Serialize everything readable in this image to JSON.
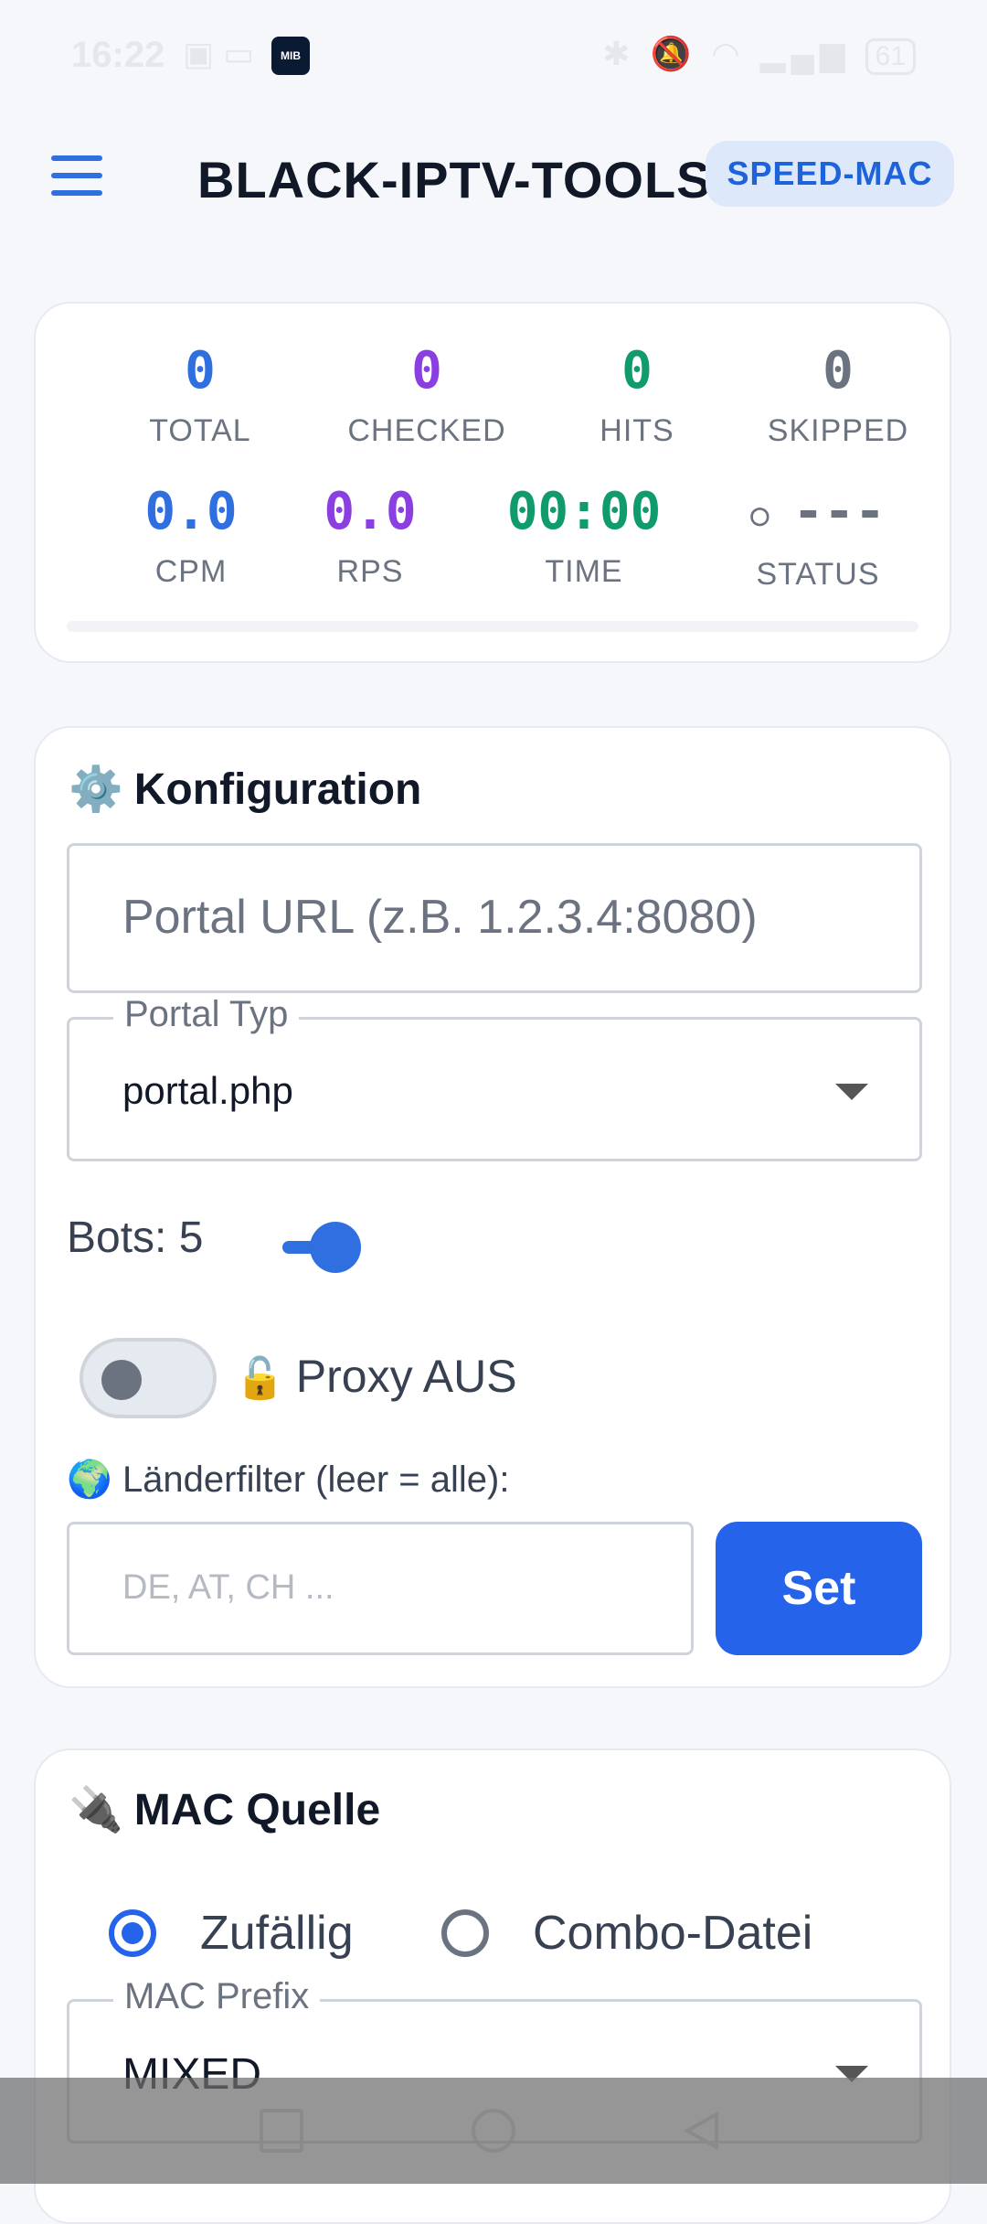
{
  "status_bar": {
    "time": "16:22",
    "battery": "61",
    "icons": [
      "nfc-icon",
      "sim-icon",
      "app-icon",
      "check-icon",
      "bluetooth-icon",
      "mute-icon",
      "wifi-icon",
      "signal-icon",
      "battery-icon"
    ]
  },
  "appbar": {
    "title": "BLACK-IPTV-TOOLS",
    "mode_chip": "SPEED-MAC",
    "app_icon_text": "MIB"
  },
  "stats": {
    "total": {
      "value": "0",
      "label": "TOTAL"
    },
    "checked": {
      "value": "0",
      "label": "CHECKED"
    },
    "hits": {
      "value": "0",
      "label": "HITS"
    },
    "skipped": {
      "value": "0",
      "label": "SKIPPED"
    },
    "cpm": {
      "value": "0.0",
      "label": "CPM"
    },
    "rps": {
      "value": "0.0",
      "label": "RPS"
    },
    "time": {
      "value": "00:00",
      "label": "TIME"
    },
    "status": {
      "value": "---",
      "label": "STATUS",
      "indicator": "○"
    }
  },
  "config": {
    "title": "Konfiguration",
    "title_icon": "⚙️",
    "portal_url_placeholder": "Portal URL (z.B. 1.2.3.4:8080)",
    "portal_type_label": "Portal Typ",
    "portal_type_value": "portal.php",
    "bots_label": "Bots: 5",
    "bots_value": 5,
    "proxy_label": "Proxy AUS",
    "proxy_icon": "🔓",
    "proxy_enabled": false,
    "country_filter_label": "Länderfilter (leer = alle):",
    "country_filter_icon": "🌍",
    "country_filter_placeholder": "DE, AT, CH ...",
    "set_button": "Set"
  },
  "mac_source": {
    "title": "MAC Quelle",
    "title_icon": "🔌",
    "options": [
      "Zufällig",
      "Combo-Datei"
    ],
    "selected": "Zufällig",
    "prefix_label": "MAC Prefix",
    "prefix_value": "MIXED"
  },
  "colors": {
    "accent": "#2563eb",
    "total": "#2f6fe0",
    "checked": "#8b3fe0",
    "hits": "#0f9b6c",
    "skipped": "#6b7280"
  }
}
